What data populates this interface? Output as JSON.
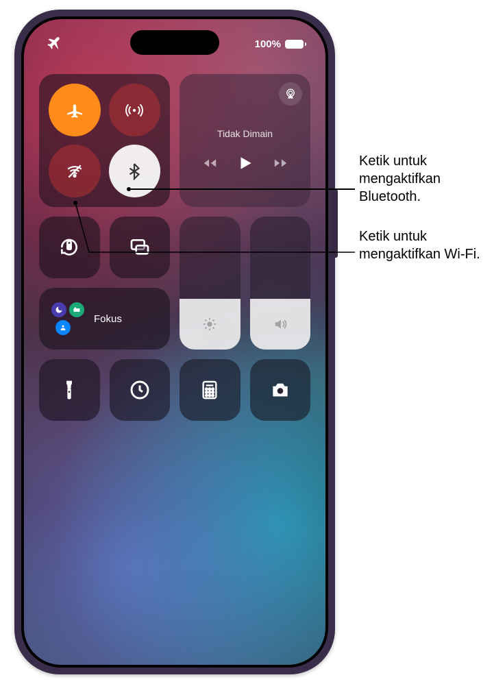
{
  "status": {
    "battery_text": "100%"
  },
  "music": {
    "title": "Tidak Dimain"
  },
  "focus": {
    "label": "Fokus"
  },
  "callouts": {
    "bluetooth": "Ketik untuk mengaktifkan Bluetooth.",
    "wifi": "Ketik untuk mengaktifkan Wi-Fi."
  },
  "icons": {
    "airplane_status": "airplane-status",
    "airplane": "airplane",
    "cellular": "cellular",
    "wifi_off": "wifi-off",
    "bluetooth": "bluetooth",
    "airplay": "airplay",
    "prev": "previous-track",
    "play": "play",
    "next": "next-track",
    "orientation_lock": "orientation-lock",
    "screen_mirror": "screen-mirroring",
    "brightness": "brightness",
    "volume": "volume",
    "flashlight": "flashlight",
    "timer": "timer",
    "calculator": "calculator",
    "camera": "camera",
    "dnd": "do-not-disturb",
    "sleep": "sleep",
    "personal": "personal"
  }
}
